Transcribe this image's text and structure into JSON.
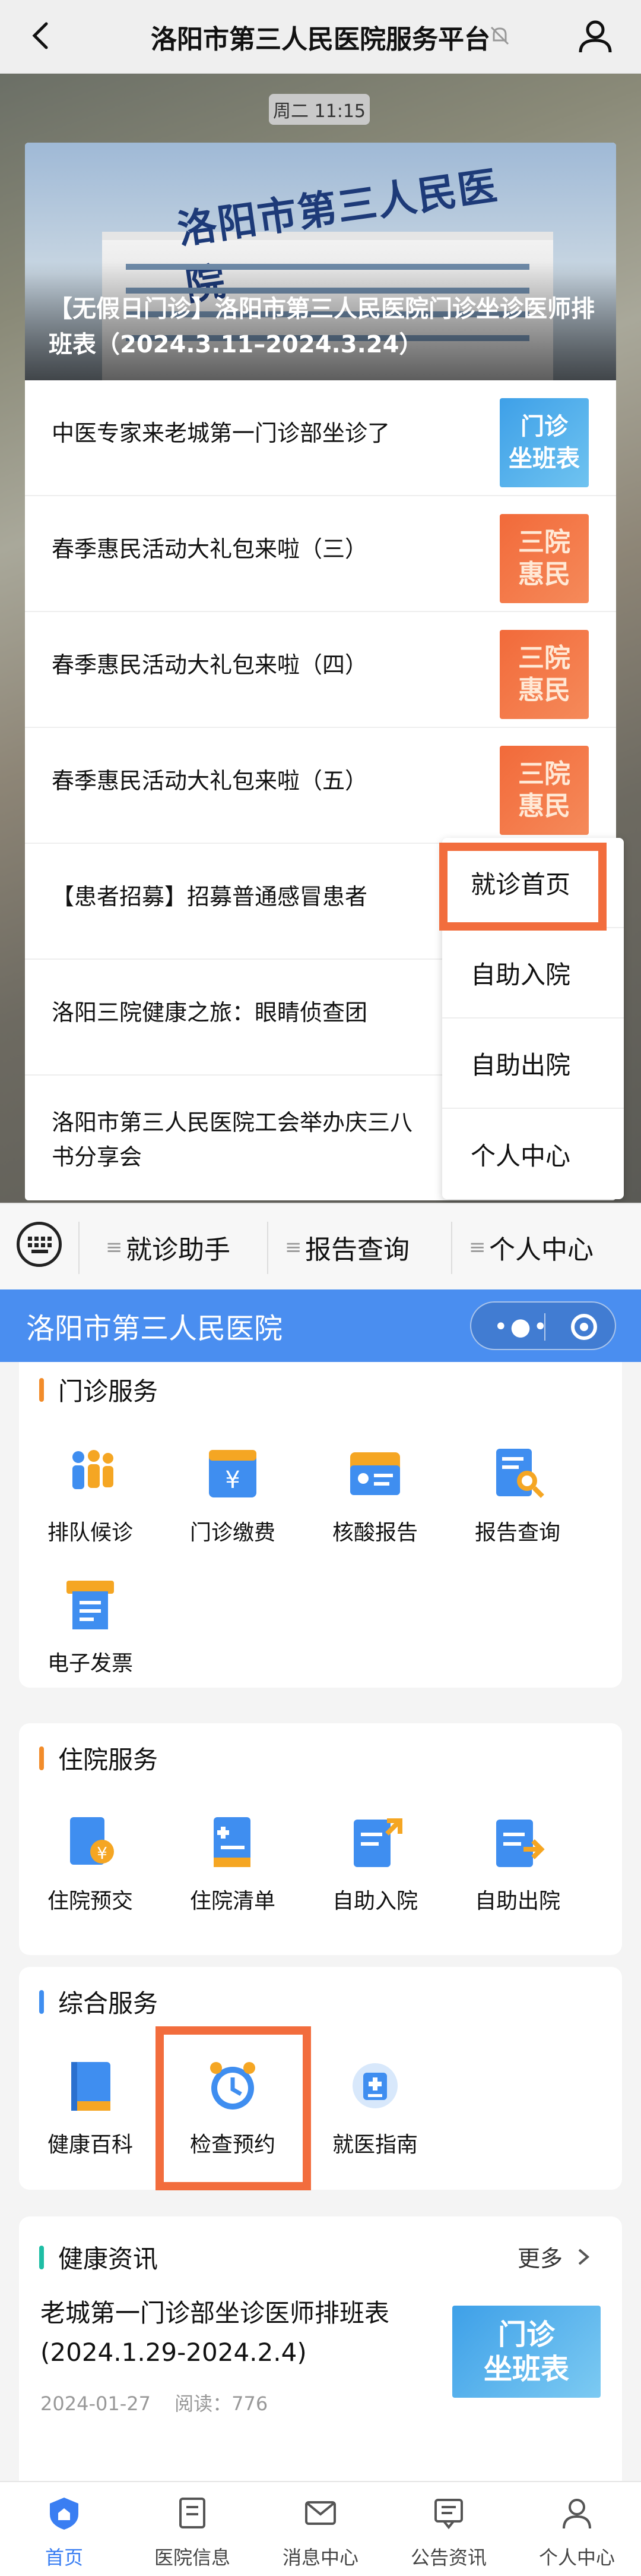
{
  "wechat": {
    "title": "洛阳市第三人民医院服务平台",
    "timestamp": "周二 11:15"
  },
  "article_card": {
    "cover_title": "【无假日门诊】洛阳市第三人民医院门诊坐诊医师排班表（2024.3.11–2024.3.24）",
    "cover_sign": "洛阳市第三人民医院",
    "news": [
      {
        "title": "中医专家来老城第一门诊部坐诊了",
        "thumb": "门诊\n坐班表",
        "thumb_color": "#3ea0e8"
      },
      {
        "title": "春季惠民活动大礼包来啦（三）",
        "thumb": "三院\n惠民",
        "thumb_color": "#f26a3a"
      },
      {
        "title": "春季惠民活动大礼包来啦（四）",
        "thumb": "三院\n惠民",
        "thumb_color": "#f26a3a"
      },
      {
        "title": "春季惠民活动大礼包来啦（五）",
        "thumb": "三院\n惠民",
        "thumb_color": "#f26a3a"
      },
      {
        "title": "【患者招募】招募普通感冒患者",
        "thumb": "",
        "thumb_color": ""
      },
      {
        "title": "洛阳三院健康之旅：眼睛侦查团",
        "thumb": "",
        "thumb_color": ""
      },
      {
        "title": "洛阳市第三人民医院工会举办庆三八\n书分享会",
        "thumb": "",
        "thumb_color": ""
      }
    ]
  },
  "popup_menu": [
    "就诊首页",
    "自助入院",
    "自助出院",
    "个人中心"
  ],
  "account_menu": [
    "就诊助手",
    "报告查询",
    "个人中心"
  ],
  "mini_program": {
    "title": "洛阳市第三人民医院",
    "outpatient": {
      "heading": "门诊服务",
      "items": [
        "排队候诊",
        "门诊缴费",
        "核酸报告",
        "报告查询",
        "电子发票"
      ]
    },
    "inpatient": {
      "heading": "住院服务",
      "items": [
        "住院预交",
        "住院清单",
        "自助入院",
        "自助出院"
      ]
    },
    "general": {
      "heading": "综合服务",
      "items": [
        "健康百科",
        "检查预约",
        "就医指南"
      ]
    },
    "news": {
      "heading": "健康资讯",
      "more": "更多",
      "article_title": "老城第一门诊部坐诊医师排班表\n(2024.1.29-2024.2.4)",
      "article_date": "2024-01-27",
      "article_reads": "阅读：776",
      "thumb": "门诊\n坐班表"
    },
    "tabs": [
      "首页",
      "医院信息",
      "消息中心",
      "公告资讯",
      "个人中心"
    ]
  },
  "colors": {
    "accent_blue": "#4a8ef0",
    "highlight_orange": "#f26d3d",
    "section_bar_orange": "#f28c2a",
    "section_bar_teal": "#1ebea5"
  }
}
